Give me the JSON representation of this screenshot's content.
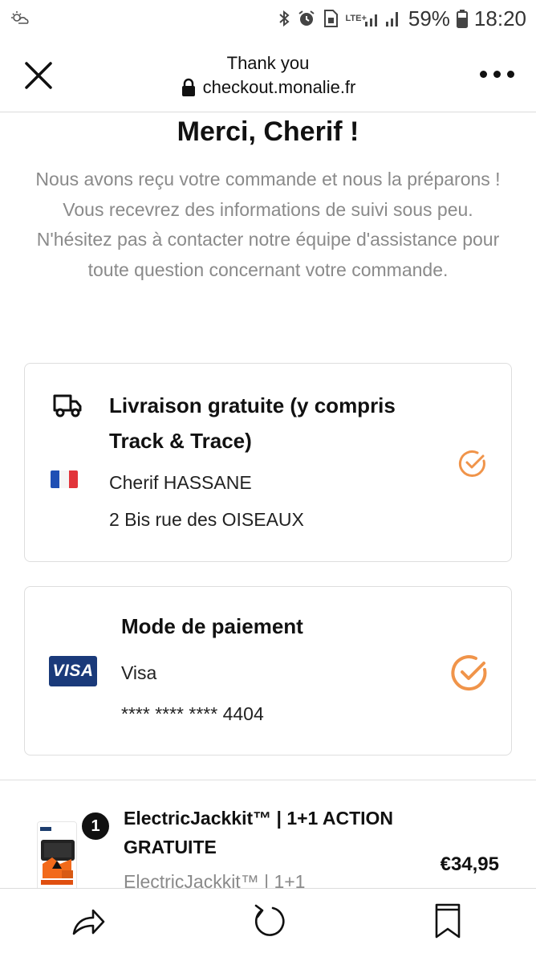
{
  "status_bar": {
    "battery": "59%",
    "time": "18:20",
    "network": "LTE+",
    "icons": [
      "weather-icon",
      "bluetooth-icon",
      "alarm-icon",
      "sim-icon",
      "signal-icon",
      "battery-icon"
    ]
  },
  "browser": {
    "page_title": "Thank you",
    "url": "checkout.monalie.fr"
  },
  "confirmation": {
    "heading": "Merci, Cherif !",
    "message": "Nous avons reçu votre commande et nous la préparons ! Vous recevrez des informations de suivi sous peu. N'hésitez pas à contacter notre équipe d'assistance pour toute question concernant votre commande."
  },
  "shipping": {
    "method": "Livraison gratuite (y compris Track & Trace)",
    "name": "Cherif HASSANE",
    "address": "2 Bis rue des OISEAUX"
  },
  "payment": {
    "title": "Mode de paiement",
    "brand_logo": "VISA",
    "brand": "Visa",
    "card_number": "**** **** **** 4404"
  },
  "product": {
    "quantity": "1",
    "name": "ElectricJackkit™ | 1+1 ACTION GRATUITE",
    "subtitle": "ElectricJackkit™ | 1+1",
    "price": "€34,95"
  },
  "colors": {
    "accent": "#f0944a",
    "visa_blue": "#1a3a7a",
    "muted_text": "#8a8a8a"
  }
}
